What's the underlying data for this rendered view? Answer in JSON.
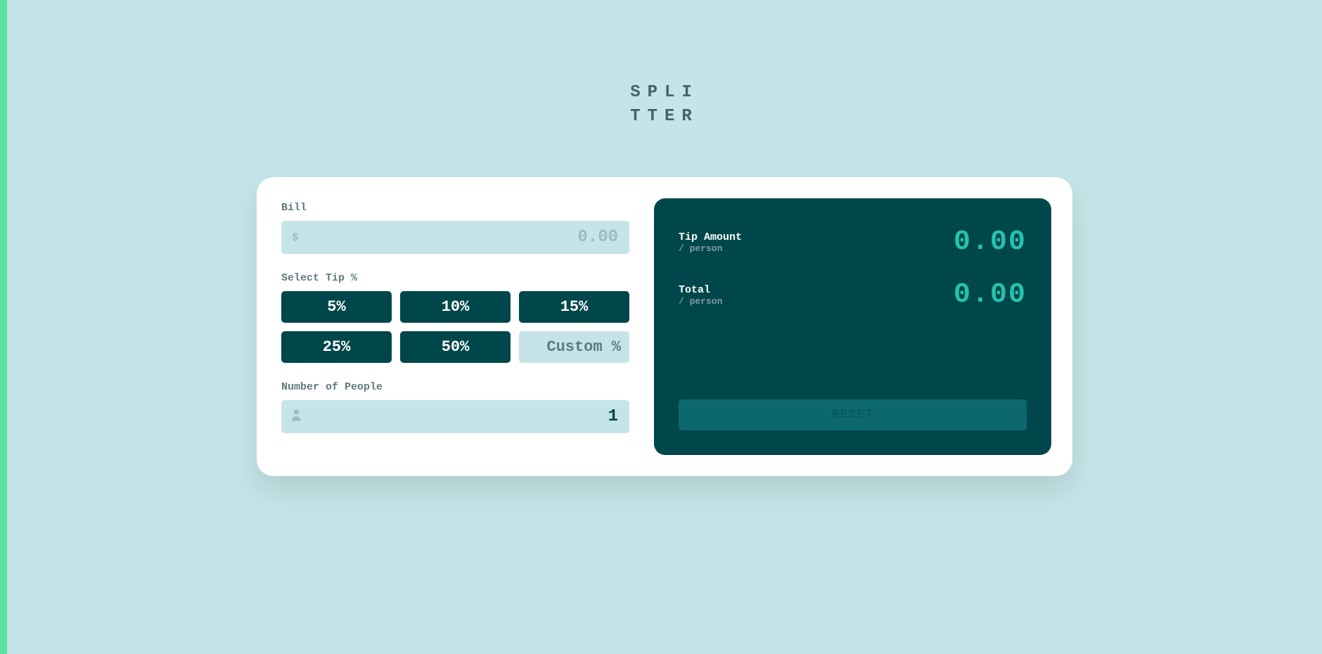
{
  "logo": {
    "line1": "SPLI",
    "line2": "TTER"
  },
  "bill": {
    "label": "Bill",
    "icon": "$",
    "placeholder": "0.00",
    "value": ""
  },
  "tip": {
    "label": "Select Tip %",
    "options": [
      "5%",
      "10%",
      "15%",
      "25%",
      "50%"
    ],
    "customPlaceholder": "Custom %",
    "customValue": ""
  },
  "people": {
    "label": "Number of People",
    "value": "1"
  },
  "results": {
    "tipAmount": {
      "label": "Tip Amount",
      "sublabel": "/ person",
      "value": "0.00"
    },
    "total": {
      "label": "Total",
      "sublabel": "/ person",
      "value": "0.00"
    }
  },
  "reset": {
    "label": "RESET"
  }
}
